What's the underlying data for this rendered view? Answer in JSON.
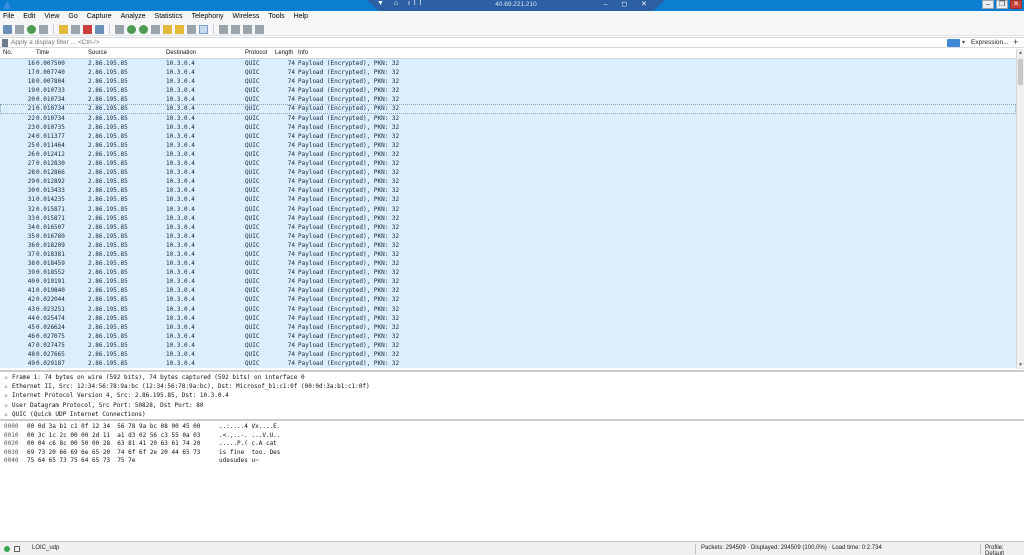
{
  "titlebar": {
    "rdp_ip": "40.69.221.210",
    "rdp_left_glyphs": "▼ ⌂ ıll",
    "rdp_right_glyphs": "– ◻ ✕",
    "win_min": "–",
    "win_max": "❐",
    "win_close": "✕"
  },
  "menu": [
    "File",
    "Edit",
    "View",
    "Go",
    "Capture",
    "Analyze",
    "Statistics",
    "Telephony",
    "Wireless",
    "Tools",
    "Help"
  ],
  "filter": {
    "placeholder": "Apply a display filter ... <Ctrl-/>",
    "dropdown": "▾",
    "expression_label": "Expression...",
    "plus": "+"
  },
  "columns": {
    "no": "No.",
    "time": "Time",
    "source": "Source",
    "destination": "Destination",
    "protocol": "Protocol",
    "length": "Length",
    "info": "Info"
  },
  "packets": [
    {
      "no": "16",
      "time": "0.007500",
      "src": "2.86.195.85",
      "dst": "10.3.0.4",
      "proto": "QUIC",
      "len": "74",
      "info": "Payload (Encrypted), PKN: 32"
    },
    {
      "no": "17",
      "time": "0.007740",
      "src": "2.86.195.85",
      "dst": "10.3.0.4",
      "proto": "QUIC",
      "len": "74",
      "info": "Payload (Encrypted), PKN: 32"
    },
    {
      "no": "18",
      "time": "0.007804",
      "src": "2.86.195.85",
      "dst": "10.3.0.4",
      "proto": "QUIC",
      "len": "74",
      "info": "Payload (Encrypted), PKN: 32"
    },
    {
      "no": "19",
      "time": "0.010733",
      "src": "2.86.195.85",
      "dst": "10.3.0.4",
      "proto": "QUIC",
      "len": "74",
      "info": "Payload (Encrypted), PKN: 32"
    },
    {
      "no": "20",
      "time": "0.010734",
      "src": "2.86.195.85",
      "dst": "10.3.0.4",
      "proto": "QUIC",
      "len": "74",
      "info": "Payload (Encrypted), PKN: 32"
    },
    {
      "no": "21",
      "time": "0.010734",
      "src": "2.86.195.85",
      "dst": "10.3.0.4",
      "proto": "QUIC",
      "len": "74",
      "info": "Payload (Encrypted), PKN: 32"
    },
    {
      "no": "22",
      "time": "0.010734",
      "src": "2.86.195.85",
      "dst": "10.3.0.4",
      "proto": "QUIC",
      "len": "74",
      "info": "Payload (Encrypted), PKN: 32"
    },
    {
      "no": "23",
      "time": "0.010735",
      "src": "2.86.195.85",
      "dst": "10.3.0.4",
      "proto": "QUIC",
      "len": "74",
      "info": "Payload (Encrypted), PKN: 32"
    },
    {
      "no": "24",
      "time": "0.011377",
      "src": "2.86.195.85",
      "dst": "10.3.0.4",
      "proto": "QUIC",
      "len": "74",
      "info": "Payload (Encrypted), PKN: 32"
    },
    {
      "no": "25",
      "time": "0.011464",
      "src": "2.86.195.85",
      "dst": "10.3.0.4",
      "proto": "QUIC",
      "len": "74",
      "info": "Payload (Encrypted), PKN: 32"
    },
    {
      "no": "26",
      "time": "0.012412",
      "src": "2.86.195.85",
      "dst": "10.3.0.4",
      "proto": "QUIC",
      "len": "74",
      "info": "Payload (Encrypted), PKN: 32"
    },
    {
      "no": "27",
      "time": "0.012830",
      "src": "2.86.195.85",
      "dst": "10.3.0.4",
      "proto": "QUIC",
      "len": "74",
      "info": "Payload (Encrypted), PKN: 32"
    },
    {
      "no": "28",
      "time": "0.012866",
      "src": "2.86.195.85",
      "dst": "10.3.0.4",
      "proto": "QUIC",
      "len": "74",
      "info": "Payload (Encrypted), PKN: 32"
    },
    {
      "no": "29",
      "time": "0.012892",
      "src": "2.86.195.85",
      "dst": "10.3.0.4",
      "proto": "QUIC",
      "len": "74",
      "info": "Payload (Encrypted), PKN: 32"
    },
    {
      "no": "30",
      "time": "0.013433",
      "src": "2.86.195.85",
      "dst": "10.3.0.4",
      "proto": "QUIC",
      "len": "74",
      "info": "Payload (Encrypted), PKN: 32"
    },
    {
      "no": "31",
      "time": "0.014235",
      "src": "2.86.195.85",
      "dst": "10.3.0.4",
      "proto": "QUIC",
      "len": "74",
      "info": "Payload (Encrypted), PKN: 32"
    },
    {
      "no": "32",
      "time": "0.015871",
      "src": "2.86.195.85",
      "dst": "10.3.0.4",
      "proto": "QUIC",
      "len": "74",
      "info": "Payload (Encrypted), PKN: 32"
    },
    {
      "no": "33",
      "time": "0.015871",
      "src": "2.86.195.85",
      "dst": "10.3.0.4",
      "proto": "QUIC",
      "len": "74",
      "info": "Payload (Encrypted), PKN: 32"
    },
    {
      "no": "34",
      "time": "0.016507",
      "src": "2.86.195.85",
      "dst": "10.3.0.4",
      "proto": "QUIC",
      "len": "74",
      "info": "Payload (Encrypted), PKN: 32"
    },
    {
      "no": "35",
      "time": "0.016780",
      "src": "2.86.195.85",
      "dst": "10.3.0.4",
      "proto": "QUIC",
      "len": "74",
      "info": "Payload (Encrypted), PKN: 32"
    },
    {
      "no": "36",
      "time": "0.018209",
      "src": "2.86.195.85",
      "dst": "10.3.0.4",
      "proto": "QUIC",
      "len": "74",
      "info": "Payload (Encrypted), PKN: 32"
    },
    {
      "no": "37",
      "time": "0.018381",
      "src": "2.86.195.85",
      "dst": "10.3.0.4",
      "proto": "QUIC",
      "len": "74",
      "info": "Payload (Encrypted), PKN: 32"
    },
    {
      "no": "38",
      "time": "0.018459",
      "src": "2.86.195.85",
      "dst": "10.3.0.4",
      "proto": "QUIC",
      "len": "74",
      "info": "Payload (Encrypted), PKN: 32"
    },
    {
      "no": "39",
      "time": "0.018552",
      "src": "2.86.195.85",
      "dst": "10.3.0.4",
      "proto": "QUIC",
      "len": "74",
      "info": "Payload (Encrypted), PKN: 32"
    },
    {
      "no": "40",
      "time": "0.019191",
      "src": "2.86.195.85",
      "dst": "10.3.0.4",
      "proto": "QUIC",
      "len": "74",
      "info": "Payload (Encrypted), PKN: 32"
    },
    {
      "no": "41",
      "time": "0.019840",
      "src": "2.86.195.85",
      "dst": "10.3.0.4",
      "proto": "QUIC",
      "len": "74",
      "info": "Payload (Encrypted), PKN: 32"
    },
    {
      "no": "42",
      "time": "0.022044",
      "src": "2.86.195.85",
      "dst": "10.3.0.4",
      "proto": "QUIC",
      "len": "74",
      "info": "Payload (Encrypted), PKN: 32"
    },
    {
      "no": "43",
      "time": "0.023251",
      "src": "2.86.195.85",
      "dst": "10.3.0.4",
      "proto": "QUIC",
      "len": "74",
      "info": "Payload (Encrypted), PKN: 32"
    },
    {
      "no": "44",
      "time": "0.025474",
      "src": "2.86.195.85",
      "dst": "10.3.0.4",
      "proto": "QUIC",
      "len": "74",
      "info": "Payload (Encrypted), PKN: 32"
    },
    {
      "no": "45",
      "time": "0.026624",
      "src": "2.86.195.85",
      "dst": "10.3.0.4",
      "proto": "QUIC",
      "len": "74",
      "info": "Payload (Encrypted), PKN: 32"
    },
    {
      "no": "46",
      "time": "0.027075",
      "src": "2.86.195.85",
      "dst": "10.3.0.4",
      "proto": "QUIC",
      "len": "74",
      "info": "Payload (Encrypted), PKN: 32"
    },
    {
      "no": "47",
      "time": "0.027475",
      "src": "2.86.195.85",
      "dst": "10.3.0.4",
      "proto": "QUIC",
      "len": "74",
      "info": "Payload (Encrypted), PKN: 32"
    },
    {
      "no": "48",
      "time": "0.027665",
      "src": "2.86.195.85",
      "dst": "10.3.0.4",
      "proto": "QUIC",
      "len": "74",
      "info": "Payload (Encrypted), PKN: 32"
    },
    {
      "no": "49",
      "time": "0.029187",
      "src": "2.86.195.85",
      "dst": "10.3.0.4",
      "proto": "QUIC",
      "len": "74",
      "info": "Payload (Encrypted), PKN: 32"
    }
  ],
  "selected_packet_no": "21",
  "details": [
    "Frame 1: 74 bytes on wire (592 bits), 74 bytes captured (592 bits) on interface 0",
    "Ethernet II, Src: 12:34:56:78:9a:bc (12:34:56:78:9a:bc), Dst: Microsof_b1:c1:0f (00:0d:3a:b1:c1:0f)",
    "Internet Protocol Version 4, Src: 2.86.195.85, Dst: 10.3.0.4",
    "User Datagram Protocol, Src Port: 50828, Dst Port: 80",
    "QUIC (Quick UDP Internet Connections)"
  ],
  "hex": [
    {
      "offset": "0000",
      "bytes": "00 0d 3a b1 c1 0f 12 34  56 78 9a bc 08 00 45 00",
      "ascii": "..:....4 Vx....E."
    },
    {
      "offset": "0010",
      "bytes": "00 3c 1c 2c 00 00 2d 11  a1 d3 02 56 c3 55 0a 03",
      "ascii": ".<.,..-. ...V.U.."
    },
    {
      "offset": "0020",
      "bytes": "00 04 c6 8c 00 50 00 28  63 81 41 20 63 61 74 20",
      "ascii": ".....P.( c.A cat "
    },
    {
      "offset": "0030",
      "bytes": "69 73 20 66 69 6e 65 20  74 6f 6f 2e 20 44 65 73",
      "ascii": "is fine  too. Des"
    },
    {
      "offset": "0040",
      "bytes": "75 64 65 73 75 64 65 73  75 7e",
      "ascii": "udesudes u~"
    }
  ],
  "status": {
    "file": "LOIC_udp",
    "stats": "Packets: 294509 · Displayed: 294509 (100.0%) · Load time: 0:2.734",
    "profile": "Profile: Default"
  },
  "colors": {
    "row_bg": "#daeefe",
    "title_bg": "#0a7fd1",
    "rdp_bg": "#2c5fa3"
  }
}
